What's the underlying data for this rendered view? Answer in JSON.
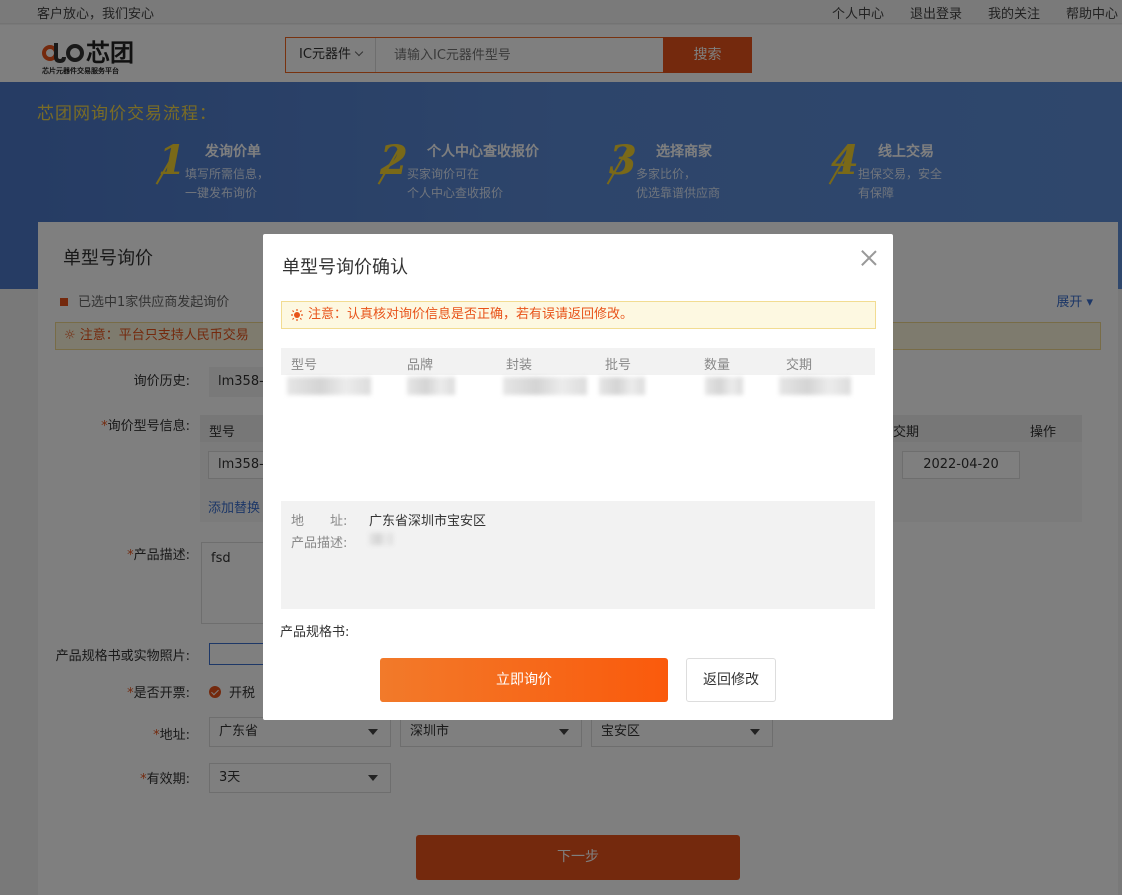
{
  "topbar": {
    "slogan": "客户放心，我们安心",
    "links": [
      "个人中心",
      "退出登录",
      "我的关注",
      "帮助中心"
    ]
  },
  "header": {
    "logo_text": "芯团",
    "logo_sub": "芯片元器件交易服务平台",
    "search": {
      "category": "IC元器件",
      "placeholder": "请输入IC元器件型号",
      "button": "搜索"
    }
  },
  "banner": {
    "title": "芯团网询价交易流程：",
    "steps": [
      {
        "num": "1",
        "title": "发询价单",
        "desc1": "填写所需信息，",
        "desc2": "一键发布询价"
      },
      {
        "num": "2",
        "title": "个人中心查收报价",
        "desc1": "买家询价可在",
        "desc2": "个人中心查收报价"
      },
      {
        "num": "3",
        "title": "选择商家",
        "desc1": "多家比价，",
        "desc2": "优选靠谱供应商"
      },
      {
        "num": "4",
        "title": "线上交易",
        "desc1": "担保交易，安全",
        "desc2": "有保障"
      }
    ]
  },
  "panel": {
    "title": "单型号询价",
    "selected": "已选中1家供应商发起询价",
    "expand": "展开",
    "notice": "注意：平台只支持人民币交易",
    "history_label": "询价历史:",
    "history_value": "lm358-",
    "model_info_label": "询价型号信息:",
    "table_head_model": "型号",
    "table_head_date": "交期",
    "table_head_op": "操作",
    "row_model": "lm358-",
    "row_date": "2022-04-20",
    "add_link": "添加替换",
    "desc_label": "产品描述:",
    "desc_value": "fsd",
    "spec_label": "产品规格书或实物照片:",
    "invoice_label": "是否开票:",
    "invoice_value": "开税",
    "address_label": "地址:",
    "province": "广东省",
    "city": "深圳市",
    "district": "宝安区",
    "validity_label": "有效期:",
    "validity_value": "3天",
    "next_button": "下一步"
  },
  "modal": {
    "title": "单型号询价确认",
    "notice": "注意：认真核对询价信息是否正确，若有误请返回修改。",
    "columns": [
      "型号",
      "品牌",
      "封装",
      "批号",
      "数量",
      "交期"
    ],
    "address_label": "地　　址:",
    "address_value": "广东省深圳市宝安区",
    "desc_label": "产品描述:",
    "spec_label": "产品规格书:",
    "confirm_button": "立即询价",
    "back_button": "返回修改"
  },
  "colors": {
    "accent": "#e8531a",
    "banner": "#5b8ad6",
    "link": "#3a6fcf"
  }
}
